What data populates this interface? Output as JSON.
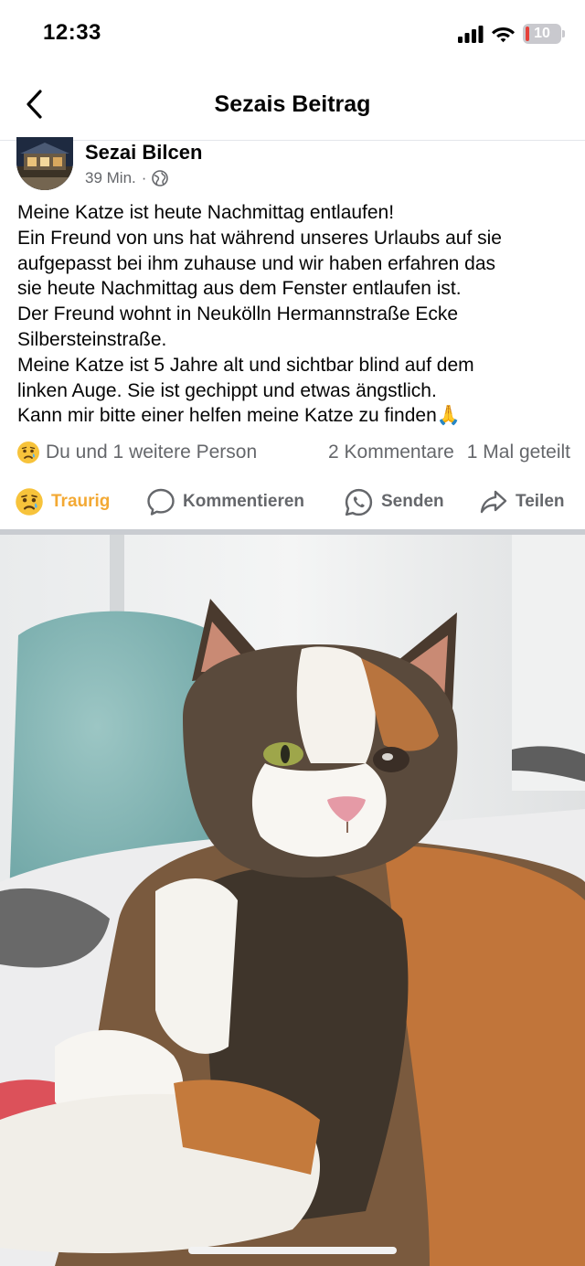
{
  "status_bar": {
    "time": "12:33",
    "battery_level": "10",
    "icons": [
      "signal-icon",
      "wifi-icon",
      "battery-icon"
    ]
  },
  "nav": {
    "title": "Sezais Beitrag",
    "back_icon": "chevron-left-icon"
  },
  "post": {
    "author": "Sezai Bilcen",
    "time": "39 Min.",
    "separator": "·",
    "audience_icon": "globe-icon",
    "lines": [
      "Meine Katze ist heute Nachmittag entlaufen!",
      "Ein Freund von uns hat während unseres Urlaubs auf sie",
      "aufgepasst bei ihm zuhause und wir haben erfahren das",
      "sie heute Nachmittag aus dem Fenster entlaufen ist.",
      "Der Freund wohnt in Neukölln Hermannstraße Ecke",
      "Silbersteinstraße.",
      "Meine Katze ist 5 Jahre alt und sichtbar blind auf dem",
      "linken Auge. Sie ist gechippt und etwas ängstlich.",
      "Kann mir bitte einer helfen meine Katze zu finden🙏"
    ],
    "reaction_summary": "Du und 1 weitere Person",
    "comments": "2 Kommentare",
    "shares": "1 Mal geteilt"
  },
  "actions": {
    "reaction": "Traurig",
    "comment": "Kommentieren",
    "send": "Senden",
    "share": "Teilen"
  },
  "colors": {
    "sad_reaction": "#f3a934",
    "secondary_text": "#65676b",
    "divider": "#c9ccd1"
  }
}
